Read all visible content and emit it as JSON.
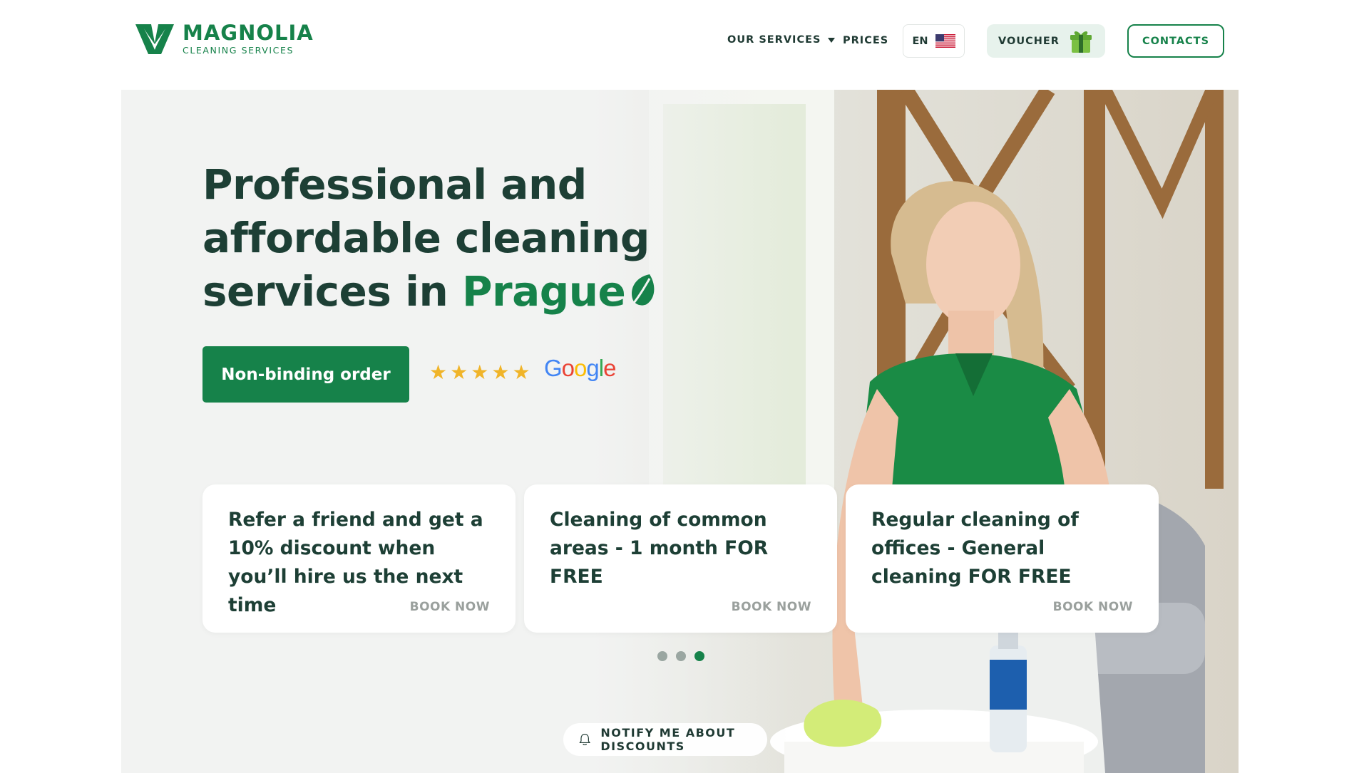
{
  "brand": {
    "name": "MAGNOLIA",
    "tagline": "CLEANING SERVICES",
    "color": "#16824a"
  },
  "nav": {
    "services_label": "OUR SERVICES",
    "prices_label": "PRICES",
    "language": "EN",
    "language_flag": "us-flag-icon",
    "voucher_label": "VOUCHER",
    "voucher_icon": "gift-icon",
    "contacts_label": "CONTACTS"
  },
  "hero": {
    "title_line1": "Professional and",
    "title_line2": "affordable cleaning",
    "title_line3_prefix": "services in",
    "title_city": "Prague",
    "cta_label": "Non-binding order",
    "rating": {
      "stars": "★",
      "value": 5,
      "max": 5,
      "source": "Google"
    }
  },
  "promos": [
    {
      "text": "Refer a friend and get a 10% discount when you’ll hire us the next time",
      "action": "BOOK NOW"
    },
    {
      "text": "Cleaning of common areas - 1 month FOR FREE",
      "action": "BOOK NOW"
    },
    {
      "text": "Regular cleaning of offices - General cleaning FOR FREE",
      "action": "BOOK NOW"
    }
  ],
  "carousel": {
    "count": 3,
    "active_index": 2
  },
  "notify": {
    "label": "NOTIFY ME ABOUT DISCOUNTS",
    "icon": "bell-icon"
  }
}
